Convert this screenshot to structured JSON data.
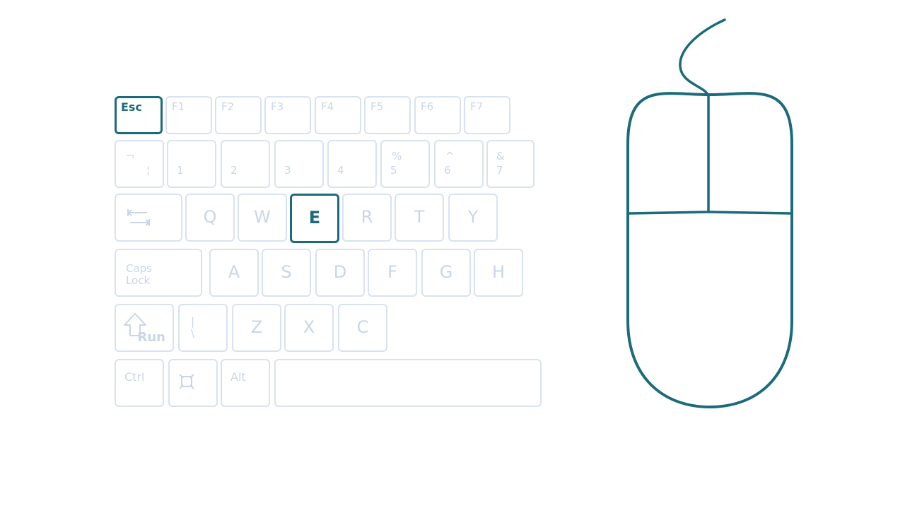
{
  "colors": {
    "accent": "#1b6b7a",
    "inactive_border": "#d9e2f0",
    "inactive_text": "#c9d6e8",
    "background": "#ffffff"
  },
  "keyboard": {
    "function_row": {
      "esc": "Esc",
      "f1": "F1",
      "f2": "F2",
      "f3": "F3",
      "f4": "F4",
      "f5": "F5",
      "f6": "F6",
      "f7": "F7"
    },
    "number_row": {
      "tilde_top": "¬",
      "tilde_bottom": "¦",
      "k1": "1",
      "k2": "2",
      "k3": "3",
      "k4": "4",
      "k5_top": "%",
      "k5": "5",
      "k6_top": "^",
      "k6": "6",
      "k7_top": "&",
      "k7": "7"
    },
    "qwerty_row": {
      "tab_icon": "tab-icon",
      "q": "Q",
      "w": "W",
      "e": "E",
      "r": "R",
      "t": "T",
      "y": "Y"
    },
    "home_row": {
      "caps_line1": "Caps",
      "caps_line2": "Lock",
      "a": "A",
      "s": "S",
      "d": "D",
      "f": "F",
      "g": "G",
      "h": "H"
    },
    "bottom_letter_row": {
      "shift_icon": "shift-arrow-icon",
      "shift_sub": "Run",
      "backslash": "|",
      "backslash_sub": "\\",
      "z": "Z",
      "x": "X",
      "c": "C"
    },
    "modifier_row": {
      "ctrl": "Ctrl",
      "win_icon": "windows-icon",
      "alt": "Alt",
      "space": ""
    },
    "highlighted_keys": [
      "Esc",
      "E"
    ]
  },
  "mouse": {
    "icon": "computer-mouse-icon"
  }
}
